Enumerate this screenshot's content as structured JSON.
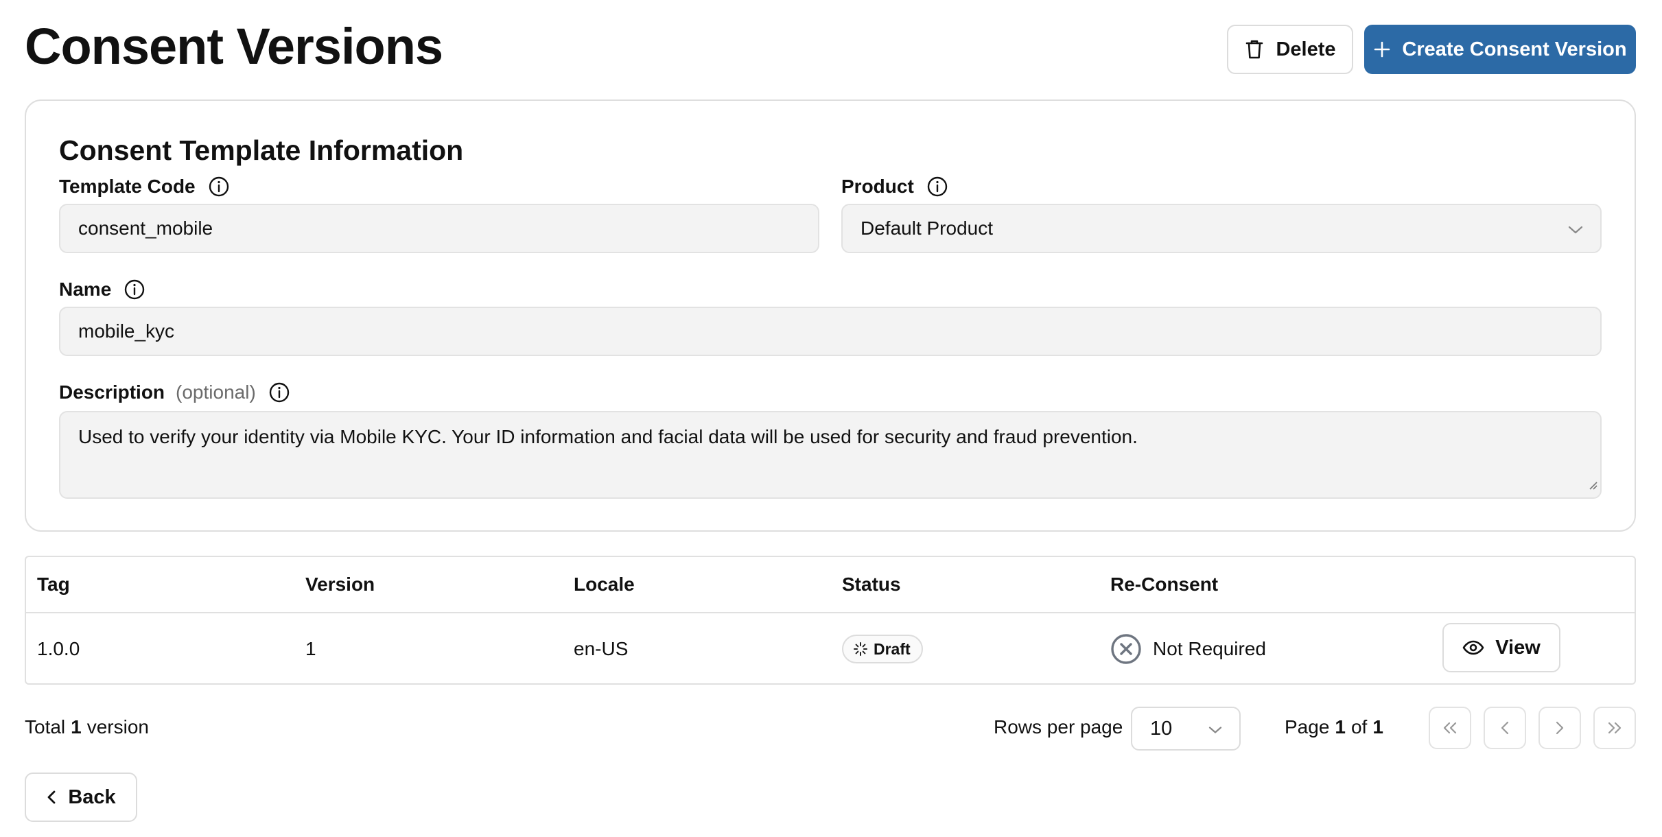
{
  "page": {
    "title": "Consent Versions"
  },
  "header_actions": {
    "delete_label": "Delete",
    "create_label": "Create Consent Version",
    "primary_color": "#2c6aa6"
  },
  "template_info": {
    "title": "Consent Template Information",
    "template_code": {
      "label": "Template Code",
      "value": "consent_mobile"
    },
    "product": {
      "label": "Product",
      "value": "Default Product"
    },
    "name": {
      "label": "Name",
      "value": "mobile_kyc"
    },
    "description": {
      "label": "Description",
      "optional": "(optional)",
      "value": "Used to verify your identity via Mobile KYC. Your ID information and facial data will be used for security and fraud prevention."
    }
  },
  "table": {
    "columns": [
      "Tag",
      "Version",
      "Locale",
      "Status",
      "Re-Consent"
    ],
    "rows": [
      {
        "tag": "1.0.0",
        "version": "1",
        "locale": "en-US",
        "status": "Draft",
        "reconsent": "Not Required",
        "action": "View"
      }
    ]
  },
  "pagination": {
    "total_prefix": "Total",
    "total_count": "1",
    "total_suffix": "version",
    "rows_per_page_label": "Rows per page",
    "rows_per_page_value": "10",
    "page_prefix": "Page",
    "page_current": "1",
    "page_of": "of",
    "page_total": "1"
  },
  "footer": {
    "back_label": "Back"
  },
  "icons": {
    "delete": "trash-icon",
    "create": "plus-icon",
    "info": "info-icon",
    "dropdown": "chevron-down-icon",
    "status": "loader-icon",
    "reconsent": "x-circle-icon",
    "view": "eye-icon",
    "first": "chevrons-left-icon",
    "prev": "chevron-left-icon",
    "next": "chevron-right-icon",
    "last": "chevrons-right-icon",
    "back": "chevron-left-icon"
  }
}
